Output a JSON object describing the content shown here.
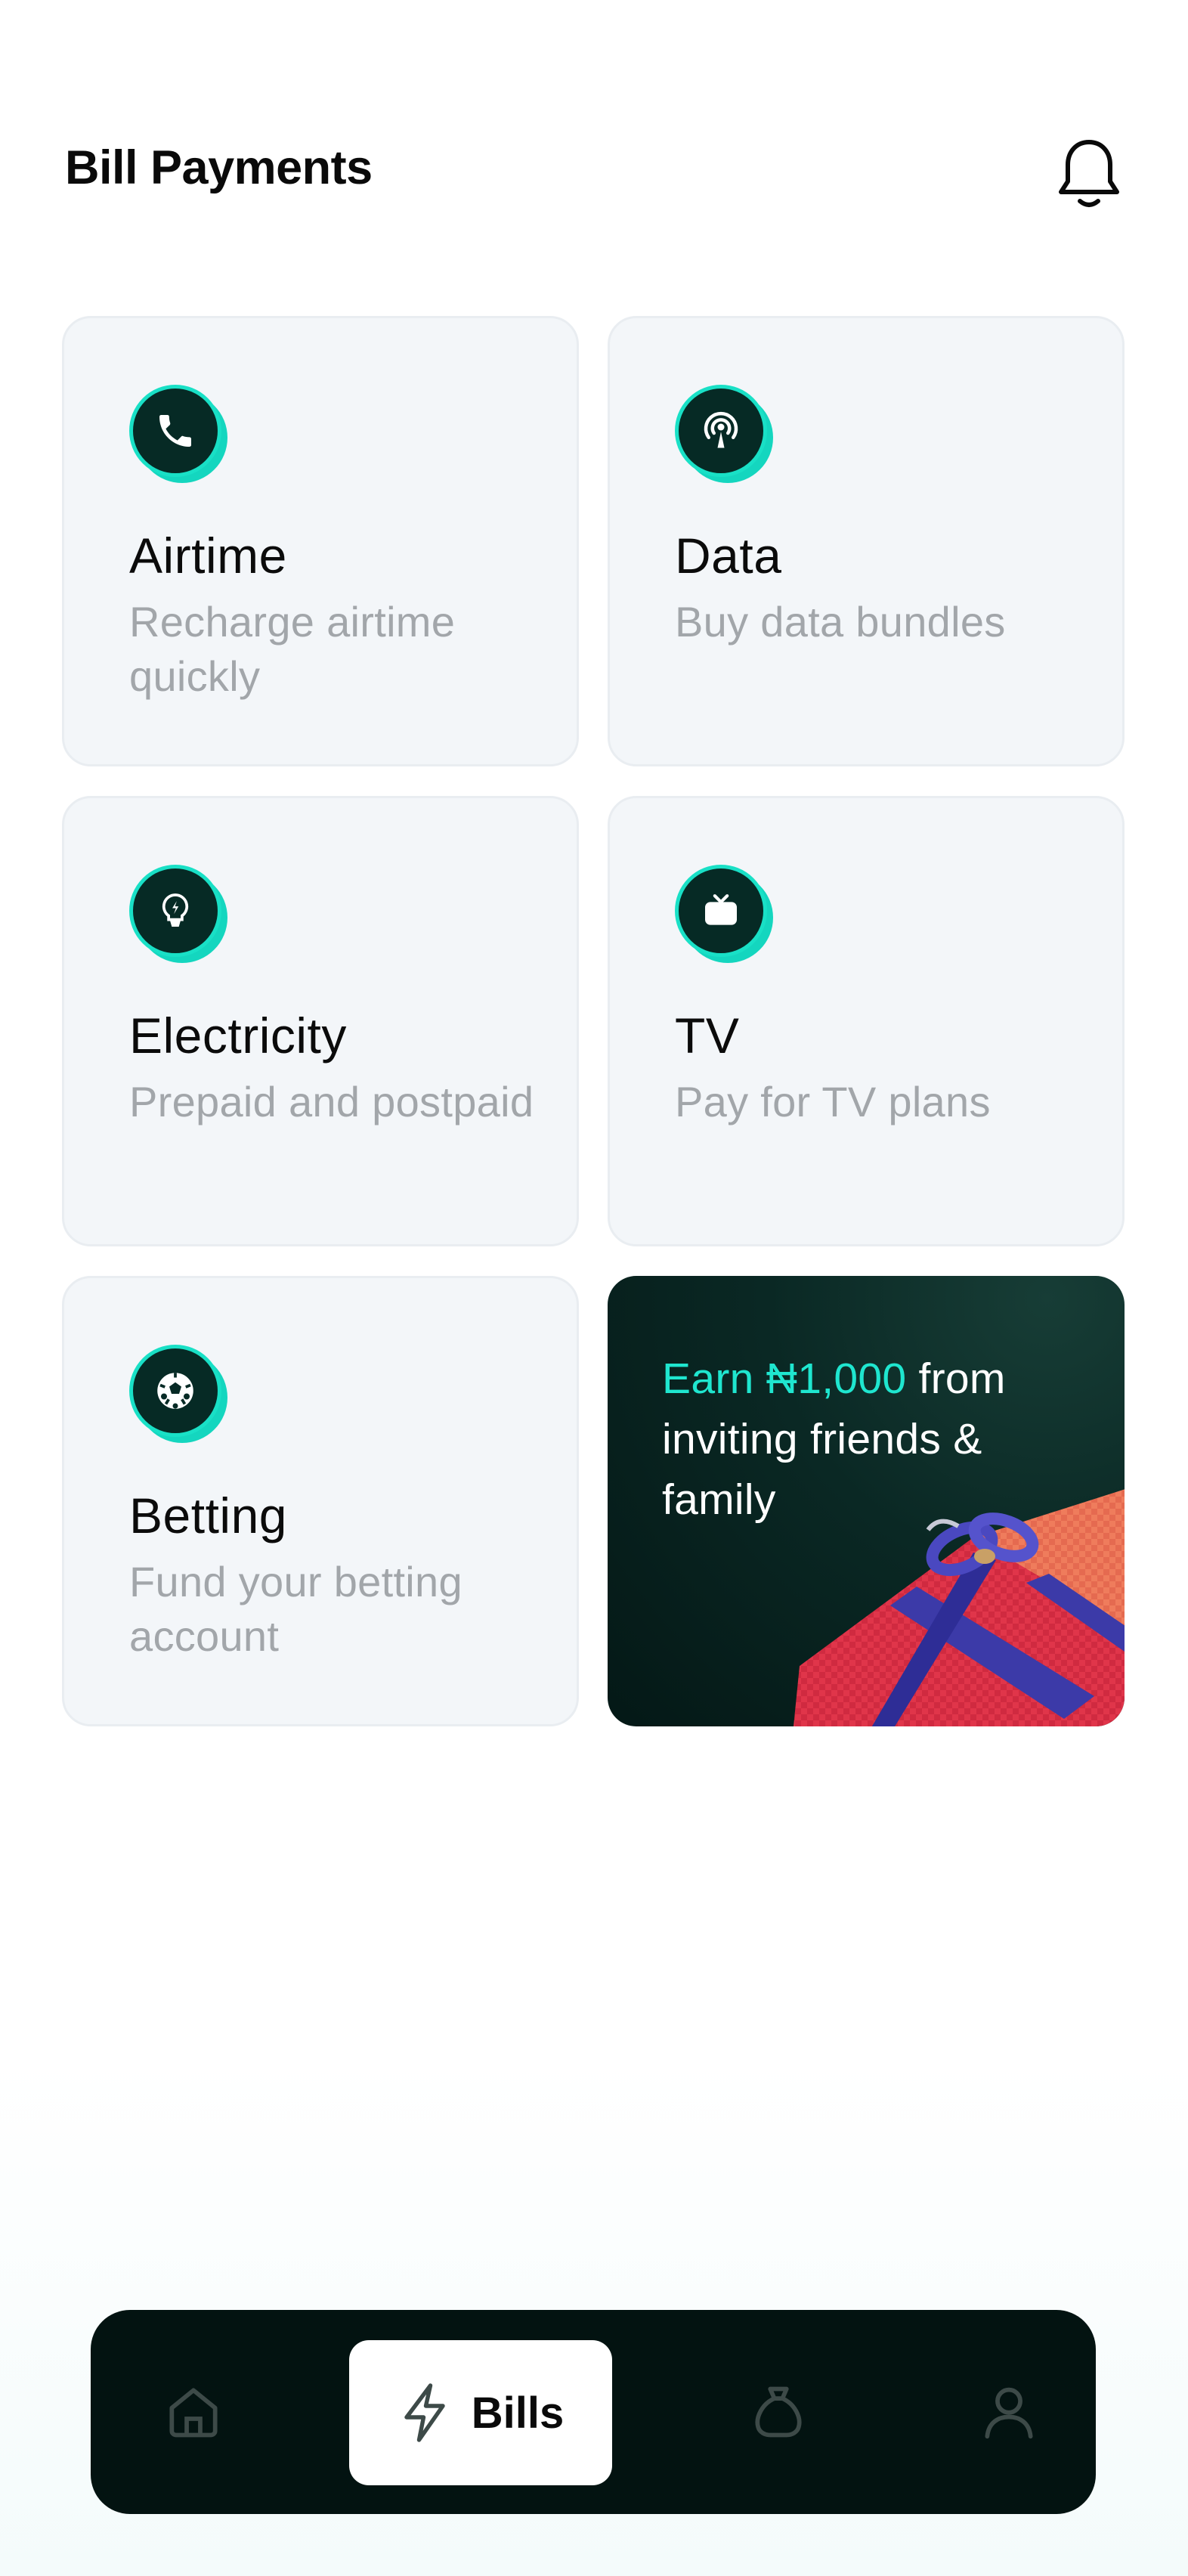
{
  "header": {
    "title": "Bill Payments"
  },
  "cards": [
    {
      "title": "Airtime",
      "desc": "Recharge airtime quickly",
      "icon": "phone-icon"
    },
    {
      "title": "Data",
      "desc": "Buy data bundles",
      "icon": "broadcast-icon"
    },
    {
      "title": "Electricity",
      "desc": "Prepaid and postpaid",
      "icon": "lightbulb-icon"
    },
    {
      "title": "TV",
      "desc": "Pay for TV plans",
      "icon": "tv-icon"
    },
    {
      "title": "Betting",
      "desc": "Fund your betting account",
      "icon": "football-icon"
    }
  ],
  "promo": {
    "highlight": "Earn ₦1,000",
    "rest": " from inviting friends & family"
  },
  "nav": {
    "items": [
      "home-icon",
      "bolt-icon",
      "money-bag-icon",
      "user-icon"
    ],
    "active_label": "Bills"
  },
  "colors": {
    "accent": "#1fe6cf",
    "dark": "#031311",
    "card_bg": "#f3f6f9",
    "muted_text": "#a2a6aa"
  }
}
